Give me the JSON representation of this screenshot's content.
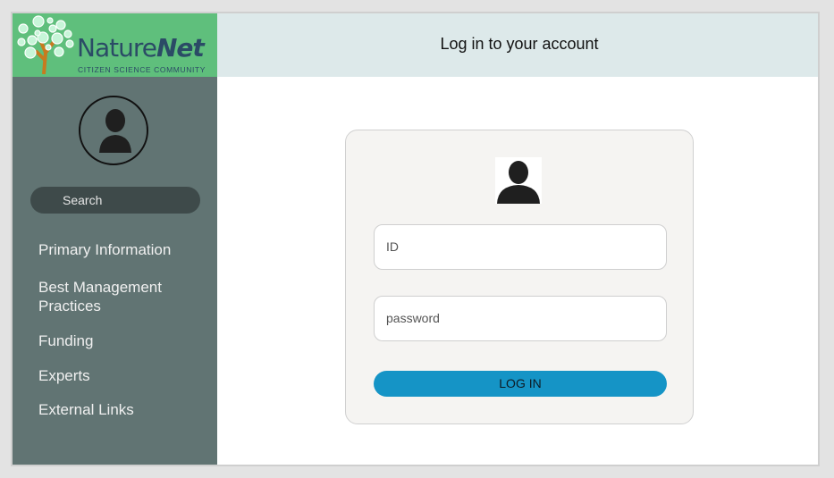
{
  "logo": {
    "brand_regular": "Nature",
    "brand_bold": "Net",
    "tagline": "CITIZEN SCIENCE COMMUNITY"
  },
  "header": {
    "title": "Log in to your account"
  },
  "sidebar": {
    "search_placeholder": "Search",
    "items": [
      {
        "label": "Primary Information"
      },
      {
        "label": "Best Management Practices"
      },
      {
        "label": "Funding"
      },
      {
        "label": "Experts"
      },
      {
        "label": "External Links"
      }
    ]
  },
  "login": {
    "id_placeholder": "ID",
    "password_placeholder": "password",
    "button_label": "LOG IN"
  },
  "colors": {
    "logo_bg": "#5fbf7c",
    "header_bg": "#dde9ea",
    "sidebar_bg": "#617473",
    "button": "#1594c6",
    "brand_text": "#2b4b66"
  }
}
